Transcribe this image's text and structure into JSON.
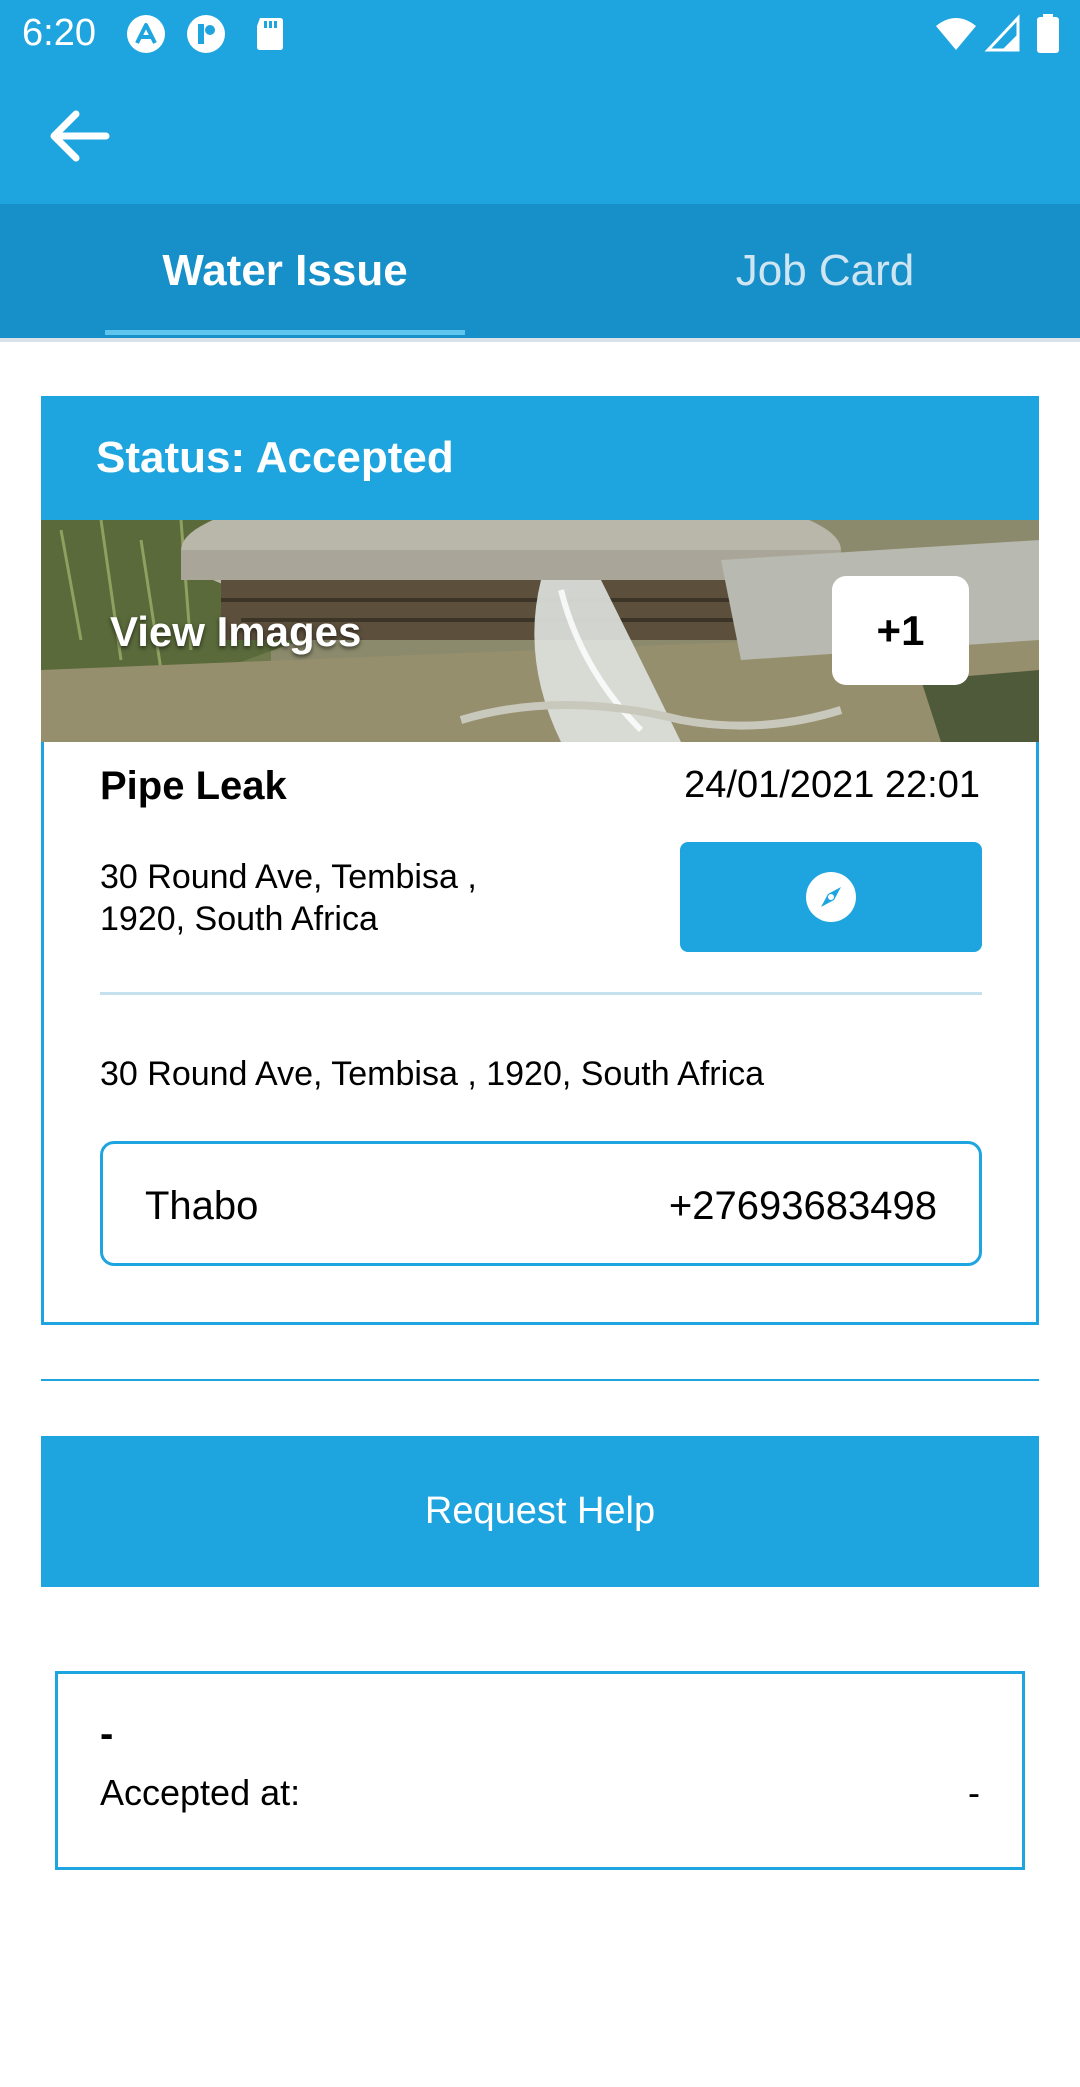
{
  "status_bar": {
    "time": "6:20",
    "notification_icons": [
      "autodesk-icon",
      "toggl-icon",
      "sd-card-icon"
    ],
    "system_icons": [
      "wifi-icon",
      "signal-icon",
      "battery-icon"
    ]
  },
  "app_bar": {
    "back_icon": "arrow-left-icon"
  },
  "tabs": [
    {
      "label": "Water Issue",
      "active": true
    },
    {
      "label": "Job Card",
      "active": false
    }
  ],
  "issue": {
    "status_text": "Status: Accepted",
    "view_images_label": "View Images",
    "extra_images_count": "+1",
    "title": "Pipe Leak",
    "datetime": "24/01/2021 22:01",
    "address_short": "30 Round Ave, Tembisa , 1920, South Africa",
    "navigate_icon": "compass-icon",
    "address_full": "30 Round Ave, Tembisa , 1920, South Africa",
    "contact": {
      "name": "Thabo",
      "phone": "+27693683498"
    }
  },
  "request_help_label": "Request Help",
  "acceptance": {
    "name": "-",
    "label": "Accepted at:",
    "value": "-"
  },
  "colors": {
    "primary": "#1ea5df",
    "tab_bar": "#1790c9",
    "white": "#ffffff"
  }
}
